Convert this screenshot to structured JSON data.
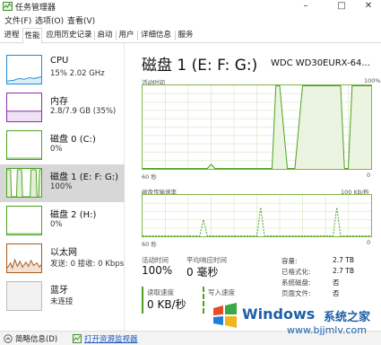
{
  "window": {
    "title": "任务管理器",
    "controls": [
      "–",
      "□",
      "✕"
    ]
  },
  "menu": [
    "文件(F)",
    "选项(O)",
    "查看(V)"
  ],
  "tabs": [
    "进程",
    "性能",
    "应用历史记录",
    "启动",
    "用户",
    "详细信息",
    "服务"
  ],
  "active_tab": "性能",
  "sidebar": [
    {
      "name": "CPU",
      "value": "15% 2.02 GHz",
      "color": "#1e90d7"
    },
    {
      "name": "内存",
      "value": "2.8/7.9 GB (35%)",
      "color": "#8b2fa8"
    },
    {
      "name": "磁盘 0 (C:)",
      "value": "0%",
      "color": "#4da11f"
    },
    {
      "name": "磁盘 1 (E: F: G:)",
      "value": "100%",
      "color": "#4da11f"
    },
    {
      "name": "磁盘 2 (H:)",
      "value": "0%",
      "color": "#4da11f"
    },
    {
      "name": "以太网",
      "value": "发送: 0 接收: 0 Kbps",
      "color": "#a7591b"
    },
    {
      "name": "蓝牙",
      "value": "未连接",
      "color": "#bbbbbb"
    }
  ],
  "main": {
    "title": "磁盘 1 (E: F: G:)",
    "model": "WDC WD30EURX-64...",
    "chart1": {
      "label": "活动时间",
      "max": "100%",
      "time": "60 秒",
      "min": "0"
    },
    "chart2": {
      "label": "磁盘传输速率",
      "max": "100 KB/秒",
      "time": "60 秒",
      "min": "0"
    },
    "stats": {
      "active_label": "活动时间",
      "active_value": "100%",
      "response_label": "平均响应时间",
      "response_value": "0 毫秒",
      "read_label": "读取速度",
      "read_value": "0 KB/秒",
      "write_label": "写入速度"
    },
    "props": [
      {
        "label": "容量:",
        "value": "2.7 TB"
      },
      {
        "label": "已格式化:",
        "value": "2.7 TB"
      },
      {
        "label": "系统磁盘:",
        "value": "否"
      },
      {
        "label": "页面文件:",
        "value": "否"
      }
    ]
  },
  "bottom": {
    "summary": "简略信息(D)",
    "monitor_link": "打开资源监视器"
  },
  "watermark": {
    "brand": "Windows",
    "cn": "系统之家",
    "url": "www.bjjmlv.com"
  },
  "chart_data": [
    {
      "type": "area",
      "title": "活动时间",
      "xlabel": "60 秒",
      "ylim": [
        0,
        100
      ],
      "y_unit": "%",
      "x": [
        0,
        5,
        10,
        14,
        16,
        17,
        18,
        19,
        20,
        21,
        22,
        25,
        30,
        34,
        35,
        36,
        38,
        40,
        42,
        45,
        48,
        50,
        52,
        53,
        54,
        55,
        57,
        60
      ],
      "series": [
        {
          "values": [
            0,
            0,
            0,
            0,
            0,
            0,
            5,
            0,
            0,
            0,
            0,
            0,
            0,
            0,
            100,
            100,
            0,
            0,
            100,
            100,
            100,
            100,
            100,
            0,
            0,
            100,
            100,
            100
          ]
        }
      ],
      "grid": true
    },
    {
      "type": "line",
      "title": "磁盘传输速率",
      "xlabel": "60 秒",
      "ylim": [
        0,
        100
      ],
      "y_unit": "KB/秒",
      "x": [
        0,
        10,
        15,
        16,
        17,
        25,
        30,
        31,
        32,
        40,
        50,
        51,
        52,
        60
      ],
      "series": [
        {
          "values": [
            0,
            0,
            0,
            40,
            0,
            0,
            0,
            70,
            0,
            0,
            0,
            70,
            0,
            0
          ]
        }
      ],
      "grid": true
    }
  ]
}
